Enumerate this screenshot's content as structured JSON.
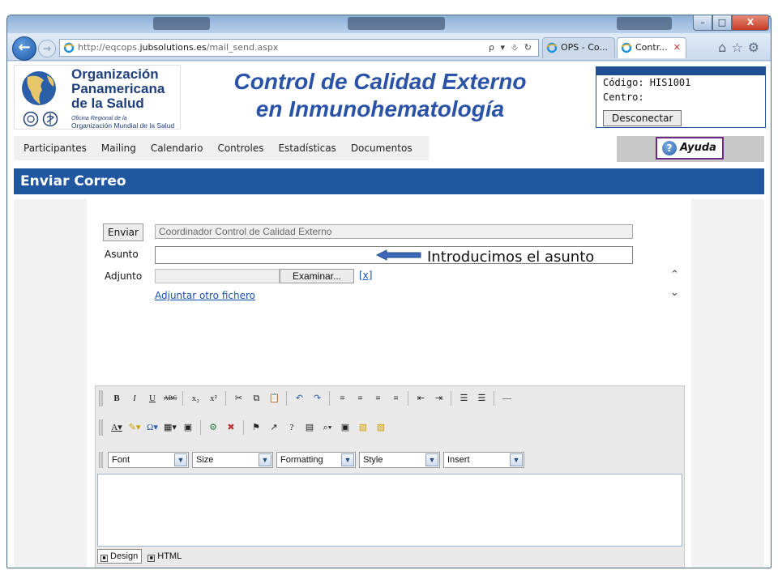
{
  "browser": {
    "url_prefix": "http://eqcops.",
    "url_domain": "jubsolutions.es",
    "url_path": "/mail_send.aspx",
    "address_controls": "ρ ▾ ⎀ ↻",
    "tabs": [
      {
        "label": "OPS - Co..."
      },
      {
        "label": "Contr...",
        "close": "✕"
      }
    ],
    "toolbar_icons": [
      "home-icon",
      "star-icon",
      "gear-icon"
    ],
    "window_controls": [
      "–",
      "□",
      "X"
    ]
  },
  "header": {
    "org_name": "Organización\nPanamericana\nde la Salud",
    "org_region": "Oficina Regional de la",
    "org_world": "Organización Mundial de la Salud",
    "title_line1": "Control de Calidad Externo",
    "title_line2": "en Inmunohematología",
    "codigo_label": "Código: HIS1001",
    "centro_label": "Centro:",
    "disconnect_label": "Desconectar"
  },
  "menu": {
    "items": [
      "Participantes",
      "Mailing",
      "Calendario",
      "Controles",
      "Estadísticas",
      "Documentos"
    ],
    "help_label": "Ayuda"
  },
  "section": {
    "title": "Enviar Correo"
  },
  "form": {
    "send_label": "Enviar",
    "from_value": "Coordinador Control de Calidad Externo",
    "subject_label": "Asunto",
    "subject_value": "",
    "attach_label": "Adjunto",
    "browse_label": "Examinar...",
    "remove_link": "[x]",
    "more_link": "Adjuntar otro fichero",
    "annotation": "Introducimos el asunto"
  },
  "editor": {
    "toolbar1": [
      "B",
      "I",
      "U",
      "ABC",
      "x₂",
      "x²",
      "✂",
      "⧉",
      "📋",
      "↶",
      "↷",
      "≡",
      "≡",
      "≡",
      "≡",
      "⇤",
      "⇥",
      "☰",
      "☰",
      "—"
    ],
    "toolbar2": [
      "A▾",
      "✎▾",
      "Ω▾",
      "▦▾",
      "▣",
      "⚙",
      "✖",
      "⚑",
      "↗",
      "?",
      "▤",
      "⌕▾",
      "▣",
      "▧",
      "▧"
    ],
    "dropdowns": {
      "font": "Font",
      "size": "Size",
      "formatting": "Formatting",
      "style": "Style",
      "insert": "Insert"
    },
    "mode_design": "Design",
    "mode_html": "HTML"
  },
  "colors": {
    "accent_blue": "#2057a0",
    "title_blue": "#2a53a8",
    "link_blue": "#1a4fb0",
    "help_border": "#6b2a84"
  }
}
